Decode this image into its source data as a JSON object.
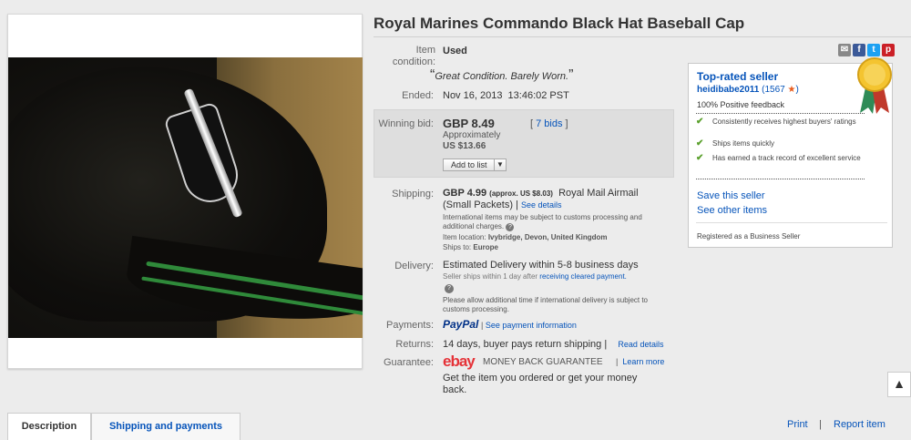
{
  "title": "Royal Marines Commando Black Hat Baseball Cap",
  "condition": {
    "label": "Item condition:",
    "value": "Used",
    "note": "Great Condition. Barely Worn."
  },
  "ended": {
    "label": "Ended:",
    "value": "Nov 16, 2013  13:46:02 PST"
  },
  "bid": {
    "label": "Winning bid:",
    "price": "GBP 8.49",
    "approx_label": "Approximately",
    "approx_value": "US $13.66",
    "bids": "7 bids",
    "add_to_list": "Add to list"
  },
  "shipping": {
    "label": "Shipping:",
    "price": "GBP 4.99",
    "approx": "(approx. US $8.03)",
    "service": "Royal Mail Airmail",
    "service2": "(Small Packets)",
    "see_details": "See details",
    "intl_note": "International items may be subject to customs processing and additional charges.",
    "location_label": "Item location:",
    "location": "Ivybridge, Devon, United Kingdom",
    "ships_to_label": "Ships to:",
    "ships_to": "Europe"
  },
  "delivery": {
    "label": "Delivery:",
    "value": "Estimated Delivery within 5-8 business days",
    "ships_within": "Seller ships within 1 day after",
    "cleared_link": "receiving cleared payment.",
    "allow_note": "Please allow additional time if international delivery is subject to customs processing."
  },
  "payments": {
    "label": "Payments:",
    "paypal": "PayPal",
    "link": "See payment information"
  },
  "returns": {
    "label": "Returns:",
    "value": "14 days, buyer pays return shipping",
    "link": "Read details"
  },
  "guarantee": {
    "label": "Guarantee:",
    "ebay": "ebay",
    "mbg": "MONEY BACK GUARANTEE",
    "learn": "Learn more",
    "text": "Get the item you ordered or get your money back."
  },
  "seller": {
    "heading": "Top-rated seller",
    "name": "heidibabe2011",
    "score": "1567",
    "feedback": "100% Positive feedback",
    "points": [
      "Consistently receives highest buyers' ratings",
      "Ships items quickly",
      "Has earned a track record of excellent service"
    ],
    "save": "Save this seller",
    "see_other": "See other items",
    "registered": "Registered as a Business Seller"
  },
  "tabs": {
    "description": "Description",
    "shipping": "Shipping and payments"
  },
  "footer": {
    "print": "Print",
    "sep": "|",
    "report": "Report item"
  },
  "colors": {
    "link": "#0654ba",
    "title_blue": "#0654ba",
    "check_green": "#5aa02c"
  }
}
